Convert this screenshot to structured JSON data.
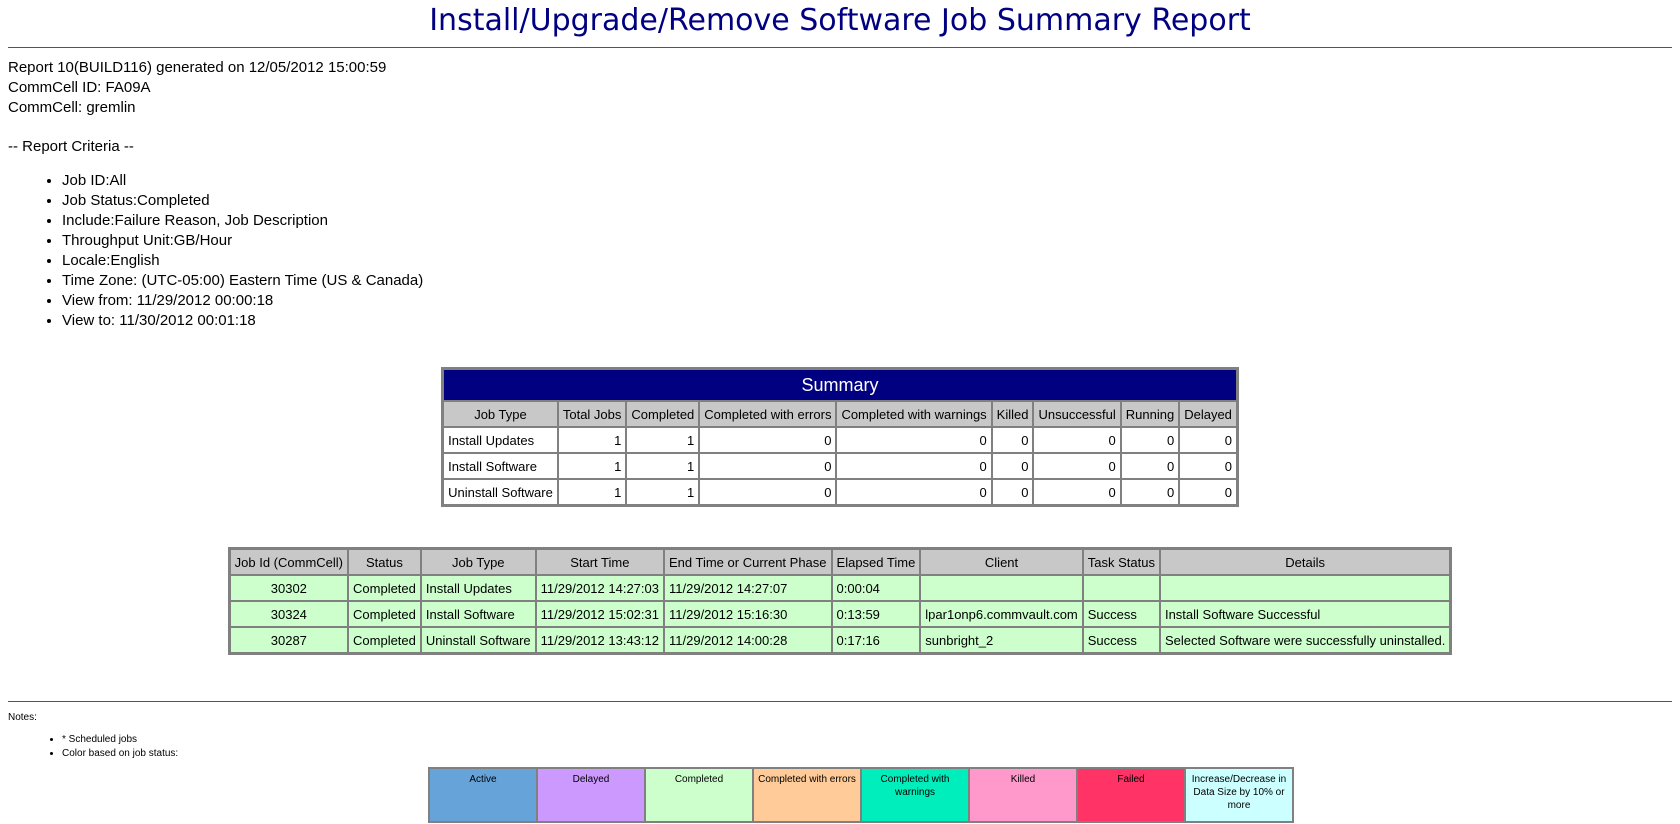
{
  "title": "Install/Upgrade/Remove Software Job Summary Report",
  "meta": {
    "report_line": "Report 10(BUILD116) generated on 12/05/2012 15:00:59",
    "commcell_id": "CommCell ID: FA09A",
    "commcell": "CommCell: gremlin"
  },
  "criteria_heading": "-- Report Criteria --",
  "criteria": [
    "Job ID:All",
    "Job Status:Completed",
    "Include:Failure Reason, Job Description",
    "Throughput Unit:GB/Hour",
    "Locale:English",
    "Time Zone: (UTC-05:00) Eastern Time (US & Canada)",
    "View from: 11/29/2012 00:00:18",
    "View to: 11/30/2012 00:01:18"
  ],
  "summary": {
    "title": "Summary",
    "headers": [
      "Job Type",
      "Total Jobs",
      "Completed",
      "Completed with errors",
      "Completed with warnings",
      "Killed",
      "Unsuccessful",
      "Running",
      "Delayed"
    ],
    "rows": [
      [
        "Install Updates",
        "1",
        "1",
        "0",
        "0",
        "0",
        "0",
        "0",
        "0"
      ],
      [
        "Install Software",
        "1",
        "1",
        "0",
        "0",
        "0",
        "0",
        "0",
        "0"
      ],
      [
        "Uninstall Software",
        "1",
        "1",
        "0",
        "0",
        "0",
        "0",
        "0",
        "0"
      ]
    ]
  },
  "jobs": {
    "headers": [
      "Job Id (CommCell)",
      "Status",
      "Job Type",
      "Start Time",
      "End Time or Current Phase",
      "Elapsed Time",
      "Client",
      "Task Status",
      "Details"
    ],
    "rows": [
      [
        "30302",
        "Completed",
        "Install Updates",
        "11/29/2012 14:27:03",
        "11/29/2012 14:27:07",
        "0:00:04",
        "",
        "",
        ""
      ],
      [
        "30324",
        "Completed",
        "Install Software",
        "11/29/2012 15:02:31",
        "11/29/2012 15:16:30",
        "0:13:59",
        "lpar1onp6.commvault.com",
        "Success",
        "Install Software Successful"
      ],
      [
        "30287",
        "Completed",
        "Uninstall Software",
        "11/29/2012 13:43:12",
        "11/29/2012 14:00:28",
        "0:17:16",
        "sunbright_2",
        "Success",
        "Selected Software were successfully uninstalled."
      ]
    ]
  },
  "notes": {
    "label": "Notes:",
    "items": [
      "* Scheduled jobs",
      "Color based on job status:"
    ]
  },
  "legend": [
    {
      "label": "Active",
      "color": "#66a3d9"
    },
    {
      "label": "Delayed",
      "color": "#cc99ff"
    },
    {
      "label": "Completed",
      "color": "#ccffcc"
    },
    {
      "label": "Completed with errors",
      "color": "#ffcc99"
    },
    {
      "label": "Completed with warnings",
      "color": "#00eebb"
    },
    {
      "label": "Killed",
      "color": "#ff99cc"
    },
    {
      "label": "Failed",
      "color": "#ff3366"
    },
    {
      "label": "Increase/Decrease in Data Size by 10% or more",
      "color": "#ccffff"
    }
  ]
}
